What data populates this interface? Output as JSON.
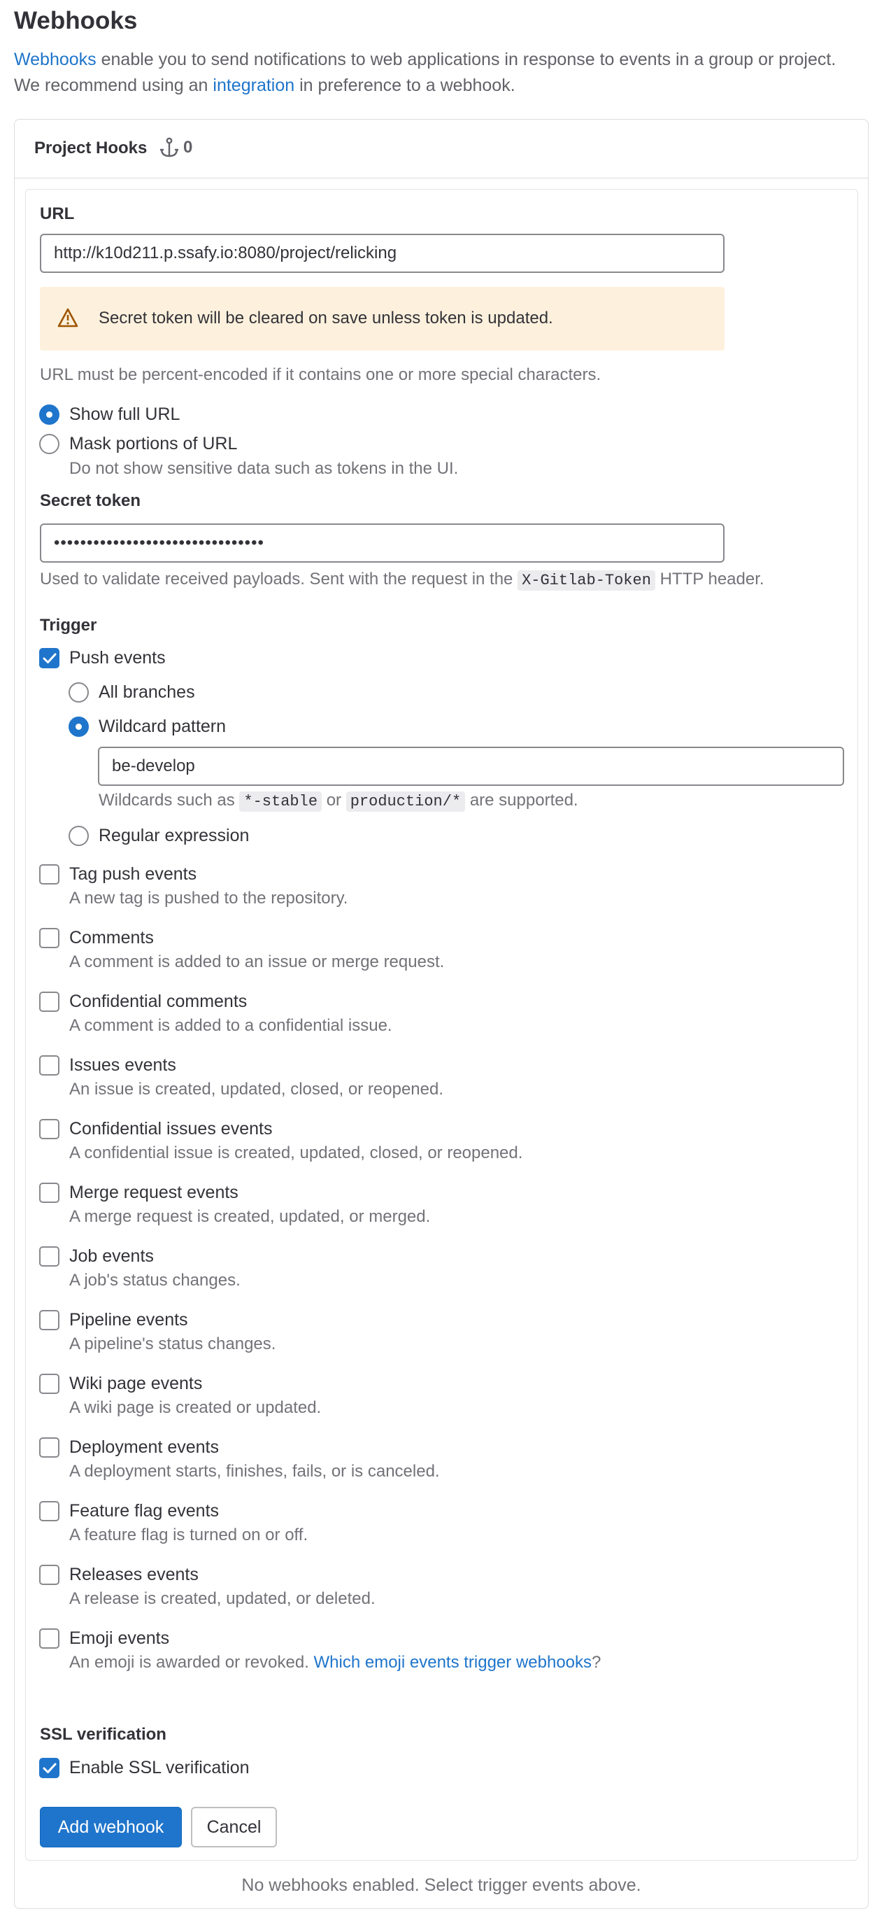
{
  "page": {
    "title": "Webhooks",
    "intro_link_webhooks": "Webhooks",
    "intro_text_1": " enable you to send notifications to web applications in response to events in a group or project. We recommend using an ",
    "intro_link_integration": "integration",
    "intro_text_2": " in preference to a webhook."
  },
  "card": {
    "title": "Project Hooks",
    "count": "0",
    "icon": "anchor-icon"
  },
  "form": {
    "url_label": "URL",
    "url_value": "http://k10d211.p.ssafy.io:8080/project/relicking",
    "alert_text": "Secret token will be cleared on save unless token is updated.",
    "url_help": "URL must be percent-encoded if it contains one or more special characters.",
    "show_full_url": "Show full URL",
    "mask_url": "Mask portions of URL",
    "mask_url_help": "Do not show sensitive data such as tokens in the UI.",
    "url_display_selected": "show_full_url",
    "secret_label": "Secret token",
    "secret_value": "••••••••••••••••••••••••••••••••",
    "secret_help_before": "Used to validate received payloads. Sent with the request in the ",
    "secret_help_code": "X-Gitlab-Token",
    "secret_help_after": " HTTP header.",
    "trigger_label": "Trigger",
    "push_events": {
      "label": "Push events",
      "checked": true,
      "all_branches": "All branches",
      "wildcard": "Wildcard pattern",
      "wildcard_value": "be-develop",
      "wildcard_help_1": "Wildcards such as ",
      "wildcard_code_1": "*-stable",
      "wildcard_help_2": " or ",
      "wildcard_code_2": "production/*",
      "wildcard_help_3": " are supported.",
      "regex": "Regular expression",
      "branch_filter_selected": "wildcard"
    },
    "events": [
      {
        "label": "Tag push events",
        "help": "A new tag is pushed to the repository.",
        "checked": false
      },
      {
        "label": "Comments",
        "help": "A comment is added to an issue or merge request.",
        "checked": false
      },
      {
        "label": "Confidential comments",
        "help": "A comment is added to a confidential issue.",
        "checked": false
      },
      {
        "label": "Issues events",
        "help": "An issue is created, updated, closed, or reopened.",
        "checked": false
      },
      {
        "label": "Confidential issues events",
        "help": "A confidential issue is created, updated, closed, or reopened.",
        "checked": false
      },
      {
        "label": "Merge request events",
        "help": "A merge request is created, updated, or merged.",
        "checked": false
      },
      {
        "label": "Job events",
        "help": "A job's status changes.",
        "checked": false
      },
      {
        "label": "Pipeline events",
        "help": "A pipeline's status changes.",
        "checked": false
      },
      {
        "label": "Wiki page events",
        "help": "A wiki page is created or updated.",
        "checked": false
      },
      {
        "label": "Deployment events",
        "help": "A deployment starts, finishes, fails, or is canceled.",
        "checked": false
      },
      {
        "label": "Feature flag events",
        "help": "A feature flag is turned on or off.",
        "checked": false
      },
      {
        "label": "Releases events",
        "help": "A release is created, updated, or deleted.",
        "checked": false
      },
      {
        "label": "Emoji events",
        "help": "An emoji is awarded or revoked. ",
        "checked": false
      }
    ],
    "emoji_link": "Which emoji events trigger webhooks",
    "emoji_after": "?",
    "ssl_label": "SSL verification",
    "ssl_option": "Enable SSL verification",
    "ssl_checked": true,
    "add_button": "Add webhook",
    "cancel_button": "Cancel"
  },
  "footer": {
    "empty_text": "No webhooks enabled. Select trigger events above."
  },
  "colors": {
    "accent": "#1f75cb",
    "alert_bg": "#fdf1dd",
    "warning_icon": "#9e5400"
  }
}
